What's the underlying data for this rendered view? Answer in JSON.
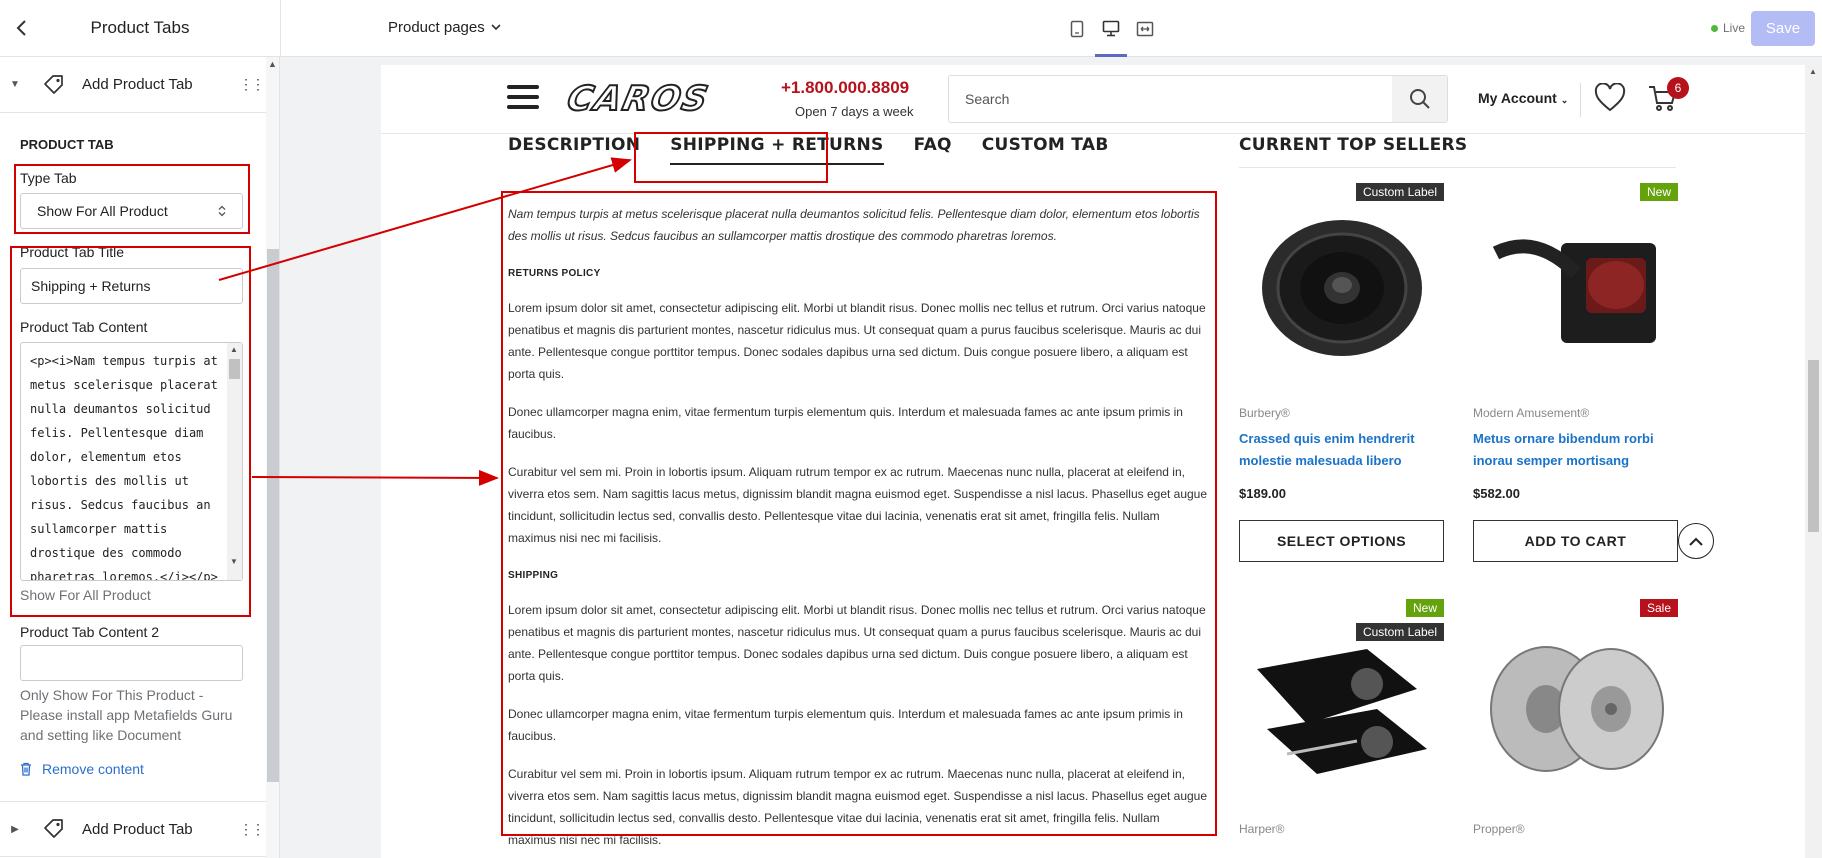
{
  "topbar": {
    "title": "Product Tabs",
    "pages_dropdown": "Product pages",
    "status": "Live",
    "save_label": "Save"
  },
  "sidebar": {
    "block_top_label": "Add Product Tab",
    "section_heading": "PRODUCT TAB",
    "type_tab_label": "Type Tab",
    "type_tab_value": "Show For All Product",
    "tab_title_label": "Product Tab Title",
    "tab_title_value": "Shipping + Returns",
    "tab_content_label": "Product Tab Content",
    "tab_content_value": "<p><i>Nam tempus turpis at metus scelerisque placerat nulla deumantos solicitud felis. Pellentesque diam dolor, elementum etos lobortis des mollis ut risus. Sedcus faucibus an sullamcorper mattis drostique des commodo pharetras loremos.</i></p>",
    "tab_content_help": "Show For All Product",
    "tab_content2_label": "Product Tab Content 2",
    "tab_content2_value": "",
    "tab_content2_help": "Only Show For This Product - Please install app Metafields Guru and setting like Document",
    "remove_label": "Remove content",
    "block_bottom_label": "Add Product Tab"
  },
  "store": {
    "logo": "CAROS",
    "phone": "+1.800.000.8809",
    "hours": "Open 7 days a week",
    "search_placeholder": "Search",
    "account": "My Account",
    "cart_count": "6"
  },
  "product_tabs": {
    "tabs": [
      "DESCRIPTION",
      "SHIPPING + RETURNS",
      "FAQ",
      "CUSTOM TAB"
    ],
    "intro": "Nam tempus turpis at metus scelerisque placerat nulla deumantos solicitud felis. Pellentesque diam dolor, elementum etos lobortis des mollis ut risus. Sedcus faucibus an sullamcorper mattis drostique des commodo pharetras loremos.",
    "returns_heading": "RETURNS POLICY",
    "para1": "Lorem ipsum dolor sit amet, consectetur adipiscing elit. Morbi ut blandit risus. Donec mollis nec tellus et rutrum. Orci varius natoque penatibus et magnis dis parturient montes, nascetur ridiculus mus. Ut consequat quam a purus faucibus scelerisque. Mauris ac dui ante. Pellentesque congue porttitor tempus. Donec sodales dapibus urna sed dictum. Duis congue posuere libero, a aliquam est porta quis.",
    "para2": "Donec ullamcorper magna enim, vitae fermentum turpis elementum quis. Interdum et malesuada fames ac ante ipsum primis in faucibus.",
    "para3": "Curabitur vel sem mi. Proin in lobortis ipsum. Aliquam rutrum tempor ex ac rutrum. Maecenas nunc nulla, placerat at eleifend in, viverra etos sem. Nam sagittis lacus metus, dignissim blandit magna euismod eget. Suspendisse a nisl lacus. Phasellus eget augue tincidunt, sollicitudin lectus sed, convallis desto. Pellentesque vitae dui lacinia, venenatis erat sit amet, fringilla felis. Nullam maximus nisi nec mi facilisis.",
    "shipping_heading": "SHIPPING",
    "para4": "Lorem ipsum dolor sit amet, consectetur adipiscing elit. Morbi ut blandit risus. Donec mollis nec tellus et rutrum. Orci varius natoque penatibus et magnis dis parturient montes, nascetur ridiculus mus. Ut consequat quam a purus faucibus scelerisque. Mauris ac dui ante. Pellentesque congue porttitor tempus. Donec sodales dapibus urna sed dictum. Duis congue posuere libero, a aliquam est porta quis.",
    "para5": "Donec ullamcorper magna enim, vitae fermentum turpis elementum quis. Interdum et malesuada fames ac ante ipsum primis in faucibus.",
    "para6": "Curabitur vel sem mi. Proin in lobortis ipsum. Aliquam rutrum tempor ex ac rutrum. Maecenas nunc nulla, placerat at eleifend in, viverra etos sem. Nam sagittis lacus metus, dignissim blandit magna euismod eget. Suspendisse a nisl lacus. Phasellus eget augue tincidunt, sollicitudin lectus sed, convallis desto. Pellentesque vitae dui lacinia, venenatis erat sit amet, fringilla felis. Nullam maximus nisi nec mi facilisis."
  },
  "sellers": {
    "title": "CURRENT TOP SELLERS",
    "products": [
      {
        "label": "Custom Label",
        "brand": "Burbery®",
        "name": "Crassed quis enim hendrerit molestie malesuada libero",
        "price": "$189.00",
        "cta": "SELECT OPTIONS"
      },
      {
        "label": "New",
        "brand": "Modern Amusement®",
        "name": "Metus ornare bibendum rorbi inorau semper mortisang",
        "price": "$582.00",
        "cta": "ADD TO CART"
      },
      {
        "label_top": "New",
        "label": "Custom Label",
        "brand": "Harper®"
      },
      {
        "label": "Sale",
        "brand": "Propper®"
      }
    ]
  },
  "colors": {
    "accent": "#5c6ac4",
    "brand_red": "#b5121b",
    "annotation_red": "#d40000",
    "link_blue": "#1a73c8"
  }
}
